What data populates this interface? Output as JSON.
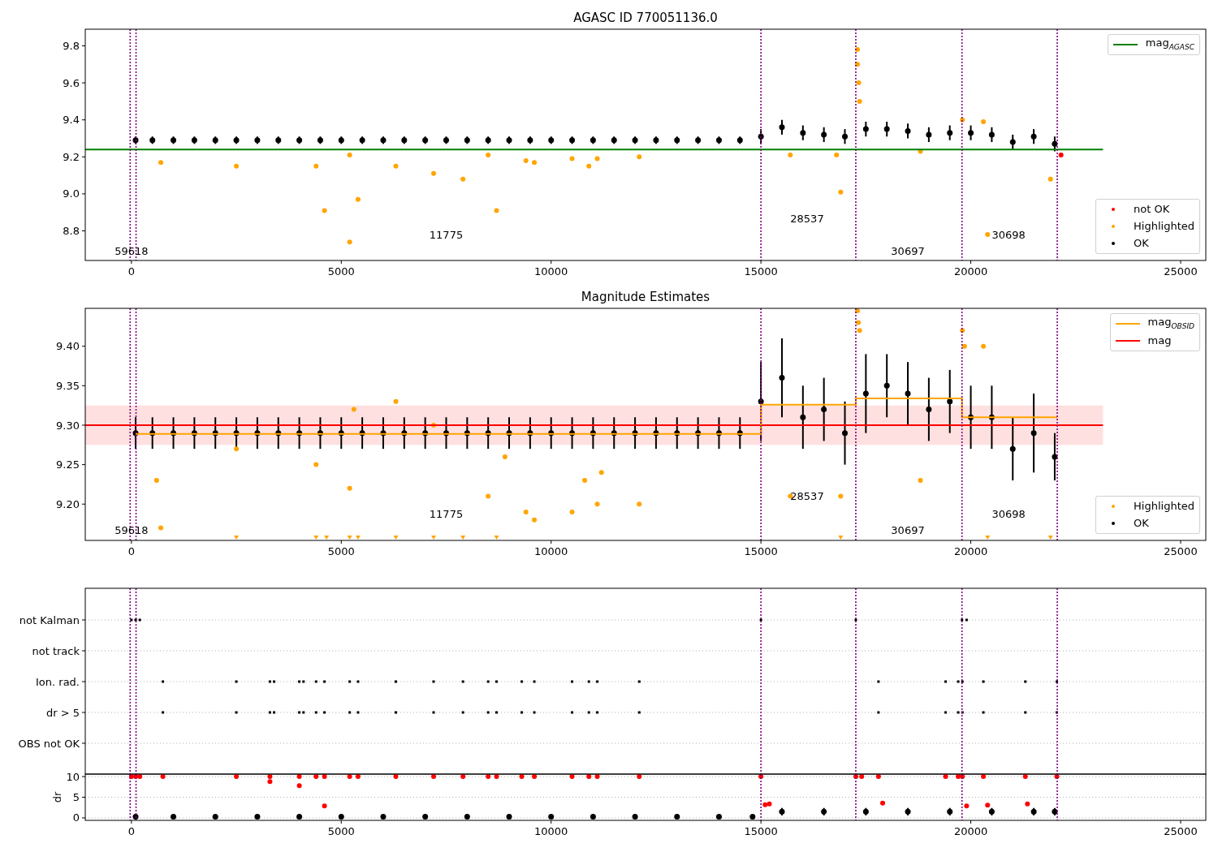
{
  "panels": [
    {
      "title": "AGASC ID 770051136.0",
      "chart_data": {
        "type": "scatter",
        "xlim": [
          -1100,
          25600
        ],
        "ylim": [
          8.64,
          9.89
        ],
        "xticks": [
          0,
          5000,
          10000,
          15000,
          20000,
          25000
        ],
        "yticks": [
          {
            "value": 8.8,
            "label": "8.8"
          },
          {
            "value": 9.0,
            "label": "9.0"
          },
          {
            "value": 9.2,
            "label": "9.2"
          },
          {
            "value": 9.4,
            "label": "9.4"
          },
          {
            "value": 9.6,
            "label": "9.6"
          },
          {
            "value": 9.8,
            "label": "9.8"
          }
        ],
        "series": [
          {
            "name": "not OK",
            "type": "scatter",
            "color": "#ff0000",
            "x": [
              22150
            ],
            "values": [
              9.21
            ]
          },
          {
            "name": "Highlighted",
            "type": "scatter",
            "color": "#ffa500",
            "x": [
              700,
              2500,
              4400,
              4600,
              5200,
              5400,
              5200,
              6300,
              7200,
              7900,
              8700,
              8500,
              9400,
              9600,
              10500,
              10900,
              11100,
              12100,
              15700,
              16800,
              16900,
              17300,
              17300,
              17330,
              17350,
              18800,
              20400,
              21900,
              19800,
              20300
            ],
            "values": [
              9.17,
              9.15,
              9.15,
              8.91,
              8.74,
              8.97,
              9.21,
              9.15,
              9.11,
              9.08,
              8.91,
              9.21,
              9.18,
              9.17,
              9.19,
              9.15,
              9.19,
              9.2,
              9.21,
              9.21,
              9.01,
              9.78,
              9.7,
              9.6,
              9.5,
              9.23,
              8.78,
              9.08,
              9.4,
              9.39
            ]
          },
          {
            "name": "OK",
            "type": "scatter",
            "color": "#000000",
            "x": [
              100,
              500,
              1000,
              1500,
              2000,
              2500,
              3000,
              3500,
              4000,
              4500,
              5000,
              5500,
              6000,
              6500,
              7000,
              7500,
              8000,
              8500,
              9000,
              9500,
              10000,
              10500,
              11000,
              11500,
              12000,
              12500,
              13000,
              13500,
              14000,
              14500,
              15000,
              15500,
              16000,
              16500,
              17000,
              17500,
              18000,
              18500,
              19000,
              19500,
              20000,
              20500,
              21000,
              21500,
              22000
            ],
            "values": [
              9.29,
              9.29,
              9.29,
              9.29,
              9.29,
              9.29,
              9.29,
              9.29,
              9.29,
              9.29,
              9.29,
              9.29,
              9.29,
              9.29,
              9.29,
              9.29,
              9.29,
              9.29,
              9.29,
              9.29,
              9.29,
              9.29,
              9.29,
              9.29,
              9.29,
              9.29,
              9.29,
              9.29,
              9.29,
              9.29,
              9.31,
              9.36,
              9.33,
              9.32,
              9.31,
              9.35,
              9.35,
              9.34,
              9.32,
              9.33,
              9.33,
              9.32,
              9.28,
              9.31,
              9.27
            ],
            "errors": [
              0.02,
              0.02,
              0.02,
              0.02,
              0.02,
              0.02,
              0.02,
              0.02,
              0.02,
              0.02,
              0.02,
              0.02,
              0.02,
              0.02,
              0.02,
              0.02,
              0.02,
              0.02,
              0.02,
              0.02,
              0.02,
              0.02,
              0.02,
              0.02,
              0.02,
              0.02,
              0.02,
              0.02,
              0.02,
              0.02,
              0.04,
              0.04,
              0.04,
              0.04,
              0.04,
              0.04,
              0.04,
              0.04,
              0.04,
              0.04,
              0.04,
              0.04,
              0.04,
              0.04,
              0.04
            ]
          },
          {
            "name": "mag$_{AGASC}$",
            "type": "line",
            "color": "#008000",
            "x": [
              -1100,
              23150
            ],
            "values": [
              9.24,
              9.24
            ]
          }
        ],
        "ref_lines": [
          {
            "axis": "x",
            "value": -30
          },
          {
            "axis": "x",
            "value": 110
          },
          {
            "axis": "x",
            "value": 15000
          },
          {
            "axis": "x",
            "value": 17260
          },
          {
            "axis": "x",
            "value": 19790
          },
          {
            "axis": "x",
            "value": 22060
          }
        ],
        "annotations": [
          "59618",
          "11775",
          "28537",
          "30697",
          "30698"
        ]
      }
    },
    {
      "title": "Magnitude Estimates",
      "chart_data": {
        "type": "scatter",
        "xlim": [
          -1100,
          25600
        ],
        "ylim": [
          9.154,
          9.448
        ],
        "xticks": [
          0,
          5000,
          10000,
          15000,
          20000,
          25000
        ],
        "yticks": [
          {
            "value": 9.2,
            "label": "9.20"
          },
          {
            "value": 9.25,
            "label": "9.25"
          },
          {
            "value": 9.3,
            "label": "9.30"
          },
          {
            "value": 9.35,
            "label": "9.35"
          },
          {
            "value": 9.4,
            "label": "9.40"
          }
        ],
        "series": [
          {
            "name": "Highlighted",
            "type": "scatter",
            "color": "#ffa500",
            "x": [
              700,
              600,
              2500,
              4400,
              5200,
              5300,
              6300,
              7200,
              8500,
              8900,
              9400,
              9600,
              10500,
              10800,
              11100,
              11200,
              12100,
              15700,
              16900,
              18800,
              17300,
              17320,
              17350,
              19800,
              19850,
              20300
            ],
            "values": [
              9.17,
              9.23,
              9.27,
              9.25,
              9.22,
              9.32,
              9.33,
              9.3,
              9.21,
              9.26,
              9.19,
              9.18,
              9.19,
              9.23,
              9.2,
              9.24,
              9.2,
              9.21,
              9.21,
              9.23,
              9.445,
              9.43,
              9.42,
              9.42,
              9.4,
              9.4
            ]
          },
          {
            "type": "scatter",
            "marker": "v",
            "color": "#ffa500",
            "x": [
              2500,
              4400,
              4650,
              5200,
              5400,
              6300,
              7200,
              7900,
              8700,
              16900,
              20400,
              21900
            ],
            "values": [
              9.158,
              9.158,
              9.158,
              9.158,
              9.158,
              9.158,
              9.158,
              9.158,
              9.158,
              9.158,
              9.158,
              9.158
            ]
          },
          {
            "name": "OK",
            "type": "scatter",
            "color": "#000000",
            "x": [
              100,
              500,
              1000,
              1500,
              2000,
              2500,
              3000,
              3500,
              4000,
              4500,
              5000,
              5500,
              6000,
              6500,
              7000,
              7500,
              8000,
              8500,
              9000,
              9500,
              10000,
              10500,
              11000,
              11500,
              12000,
              12500,
              13000,
              13500,
              14000,
              14500,
              15000,
              15500,
              16000,
              16500,
              17000,
              17500,
              18000,
              18500,
              19000,
              19500,
              20000,
              20500,
              21000,
              21500,
              22000
            ],
            "values": [
              9.29,
              9.29,
              9.29,
              9.29,
              9.29,
              9.29,
              9.29,
              9.29,
              9.29,
              9.29,
              9.29,
              9.29,
              9.29,
              9.29,
              9.29,
              9.29,
              9.29,
              9.29,
              9.29,
              9.29,
              9.29,
              9.29,
              9.29,
              9.29,
              9.29,
              9.29,
              9.29,
              9.29,
              9.29,
              9.29,
              9.33,
              9.36,
              9.31,
              9.32,
              9.29,
              9.34,
              9.35,
              9.34,
              9.32,
              9.33,
              9.31,
              9.31,
              9.27,
              9.29,
              9.26
            ],
            "errors": [
              0.02,
              0.02,
              0.02,
              0.02,
              0.02,
              0.02,
              0.02,
              0.02,
              0.02,
              0.02,
              0.02,
              0.02,
              0.02,
              0.02,
              0.02,
              0.02,
              0.02,
              0.02,
              0.02,
              0.02,
              0.02,
              0.02,
              0.02,
              0.02,
              0.02,
              0.02,
              0.02,
              0.02,
              0.02,
              0.02,
              0.05,
              0.05,
              0.04,
              0.04,
              0.04,
              0.05,
              0.04,
              0.04,
              0.04,
              0.04,
              0.04,
              0.04,
              0.04,
              0.05,
              0.03
            ]
          },
          {
            "name": "mag$_{OBSID}$",
            "type": "line",
            "color": "#ffa500",
            "x": [
              100,
              15000,
              15000,
              17260,
              17260,
              19790,
              19790,
              22060
            ],
            "values": [
              9.289,
              9.289,
              9.326,
              9.326,
              9.334,
              9.334,
              9.31,
              9.31
            ]
          },
          {
            "name": "mag",
            "type": "line",
            "color": "#ff0000",
            "x": [
              -1100,
              23150
            ],
            "values": [
              9.3,
              9.3
            ]
          }
        ],
        "bands": [
          {
            "axis": "y",
            "from": 9.275,
            "to": 9.325,
            "color": "#ff0000"
          }
        ],
        "ref_lines": [
          {
            "axis": "x",
            "value": -30
          },
          {
            "axis": "x",
            "value": 110
          },
          {
            "axis": "x",
            "value": 15000
          },
          {
            "axis": "x",
            "value": 17260
          },
          {
            "axis": "x",
            "value": 19790
          },
          {
            "axis": "x",
            "value": 22060
          }
        ],
        "annotations": [
          "59618",
          "11775",
          "28537",
          "30697",
          "30698"
        ]
      }
    }
  ],
  "flags": {
    "labels": [
      "not Kalman",
      "not track",
      "Ion. rad.",
      "dr > 5",
      "OBS not OK"
    ]
  },
  "dr": {
    "chart_data": {
      "type": "scatter",
      "grid": true,
      "ylabel": "dr",
      "xlim": [
        -1100,
        25600
      ],
      "ylim": [
        -0.6,
        10.6
      ],
      "xticks": [
        0,
        5000,
        10000,
        15000,
        20000,
        25000
      ],
      "yticks": [
        0,
        5,
        10
      ],
      "series": [
        {
          "type": "scatter",
          "color": "#ff0000",
          "x": [
            0,
            100,
            200,
            750,
            2500,
            3300,
            3300,
            4000,
            4000,
            4400,
            4600,
            4600,
            5200,
            5400,
            6300,
            7200,
            7900,
            8500,
            8700,
            9300,
            9600,
            10500,
            10900,
            11100,
            12100,
            15000,
            15100,
            15200,
            17260,
            17400,
            17800,
            17900,
            19400,
            19700,
            19800,
            19900,
            20300,
            20400,
            21300,
            21350,
            22050
          ],
          "values": [
            10,
            10,
            10,
            10,
            10,
            10,
            8.8,
            10,
            7.8,
            10,
            10,
            2.9,
            10,
            10,
            10,
            10,
            10,
            10,
            10,
            10,
            10,
            10,
            10,
            10,
            10,
            10,
            3.2,
            3.4,
            10,
            10,
            10,
            3.6,
            10,
            10,
            10,
            2.9,
            10,
            3.1,
            10,
            3.4,
            10
          ]
        },
        {
          "type": "scatter",
          "color": "#000000",
          "x": [
            100,
            1000,
            2000,
            3000,
            4000,
            5000,
            6000,
            7000,
            8000,
            9000,
            10000,
            11000,
            12000,
            13000,
            14000,
            14800,
            15500,
            16500,
            17500,
            18500,
            19500,
            20500,
            21500,
            22000
          ],
          "values": [
            0.3,
            0.3,
            0.3,
            0.3,
            0.3,
            0.3,
            0.3,
            0.3,
            0.3,
            0.3,
            0.3,
            0.3,
            0.3,
            0.3,
            0.3,
            0.3,
            1.5,
            1.5,
            1.5,
            1.5,
            1.5,
            1.5,
            1.5,
            1.5
          ],
          "errors": [
            0.3,
            0.3,
            0.3,
            0.3,
            0.3,
            0.3,
            0.3,
            0.3,
            0.3,
            0.3,
            0.3,
            0.3,
            0.3,
            0.3,
            0.3,
            0.3,
            0.9,
            0.9,
            0.9,
            0.9,
            0.9,
            0.9,
            0.9,
            0.9
          ]
        }
      ],
      "ref_lines": [
        {
          "axis": "x",
          "value": -30
        },
        {
          "axis": "x",
          "value": 110
        },
        {
          "axis": "x",
          "value": 15000
        },
        {
          "axis": "x",
          "value": 17260
        },
        {
          "axis": "x",
          "value": 19790
        },
        {
          "axis": "x",
          "value": 22060
        }
      ]
    }
  }
}
